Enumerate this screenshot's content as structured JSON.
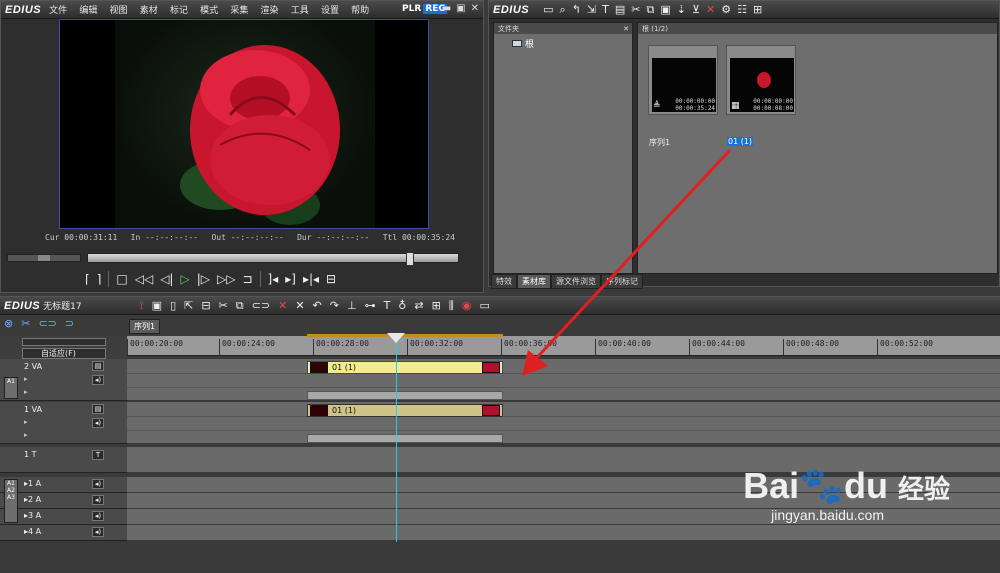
{
  "app": {
    "logo": "EDIUS"
  },
  "player": {
    "menu": [
      "文件",
      "编辑",
      "视图",
      "素材",
      "标记",
      "模式",
      "采集",
      "渲染",
      "工具",
      "设置",
      "帮助"
    ],
    "plr": "PLR",
    "rec": "REC",
    "timecodes": {
      "cur_label": "Cur",
      "cur": "00:00:31:11",
      "in_label": "In",
      "in": "--:--:--:--",
      "out_label": "Out",
      "out": "--:--:--:--",
      "dur_label": "Dur",
      "dur": "--:--:--:--",
      "ttl_label": "Ttl",
      "ttl": "00:00:35:24"
    }
  },
  "bin": {
    "folder_header": "文件夹",
    "root_label": "根",
    "clips_header": "根 (1/2)",
    "clips": [
      {
        "name": "序列1",
        "tc_in": "00:00:00:00",
        "tc_out": "00:00:35:24"
      },
      {
        "name": "01 (1)",
        "tc_in": "00:00:00:00",
        "tc_out": "00:00:08:00"
      }
    ],
    "tabs": [
      "特效",
      "素材库",
      "源文件浏览",
      "序列标记"
    ]
  },
  "timeline": {
    "title": "无标题17",
    "sequence_tab": "序列1",
    "mode_label": "自适应(F)",
    "ruler": [
      "00:00:20:00",
      "00:00:24:00",
      "00:00:28:00",
      "00:00:32:00",
      "00:00:36:00",
      "00:00:40:00",
      "00:00:44:00",
      "00:00:48:00",
      "00:00:52:00"
    ],
    "tracks": [
      {
        "name": "2 VA",
        "clip": "01 (1)"
      },
      {
        "name": "1 VA",
        "clip": "01 (1)"
      },
      {
        "name": "1 T"
      },
      {
        "name": "1 A"
      },
      {
        "name": "2 A"
      },
      {
        "name": "3 A"
      },
      {
        "name": "4 A"
      }
    ]
  },
  "watermark": {
    "brand": "Bai",
    "brand2": "经验",
    "url": "jingyan.baidu.com"
  }
}
